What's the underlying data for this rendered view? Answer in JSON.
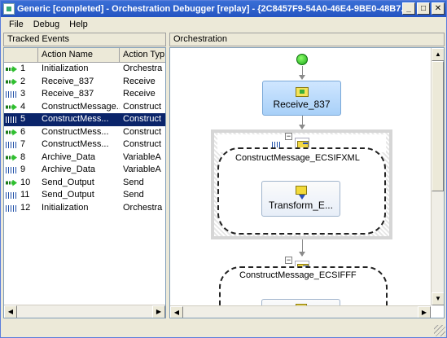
{
  "window": {
    "title": "Generic [completed] - Orchestration Debugger [replay] - {2C8457F9-54A0-46E4-9BE0-48B7..."
  },
  "menu": [
    "File",
    "Debug",
    "Help"
  ],
  "left_panel": {
    "header": "Tracked Events",
    "columns": [
      "",
      "Action Name",
      "Action Typ"
    ],
    "rows": [
      {
        "num": "1",
        "name": "Initialization",
        "type": "Orchestra",
        "icon": "green-arrow-icon"
      },
      {
        "num": "2",
        "name": "Receive_837",
        "type": "Receive",
        "icon": "green-arrow-icon"
      },
      {
        "num": "3",
        "name": "Receive_837",
        "type": "Receive",
        "icon": "blue-bars-icon"
      },
      {
        "num": "4",
        "name": "ConstructMessage...",
        "type": "Construct",
        "icon": "green-arrow-icon"
      },
      {
        "num": "5",
        "name": "ConstructMess...",
        "type": "Construct",
        "icon": "blue-bars-icon",
        "selected": true
      },
      {
        "num": "6",
        "name": "ConstructMess...",
        "type": "Construct",
        "icon": "green-arrow-icon"
      },
      {
        "num": "7",
        "name": "ConstructMess...",
        "type": "Construct",
        "icon": "blue-bars-icon"
      },
      {
        "num": "8",
        "name": "Archive_Data",
        "type": "VariableA",
        "icon": "green-arrow-icon"
      },
      {
        "num": "9",
        "name": "Archive_Data",
        "type": "VariableA",
        "icon": "blue-bars-icon"
      },
      {
        "num": "10",
        "name": "Send_Output",
        "type": "Send",
        "icon": "green-arrow-icon"
      },
      {
        "num": "11",
        "name": "Send_Output",
        "type": "Send",
        "icon": "blue-bars-icon"
      },
      {
        "num": "12",
        "name": "Initialization",
        "type": "Orchestra",
        "icon": "blue-bars-icon"
      }
    ]
  },
  "right_panel": {
    "header": "Orchestration",
    "shapes": {
      "receive": "Receive_837",
      "scope1": "ConstructMessage_ECSIFXML",
      "transform": "Transform_E...",
      "scope2": "ConstructMessage_ECSIFFF"
    }
  }
}
